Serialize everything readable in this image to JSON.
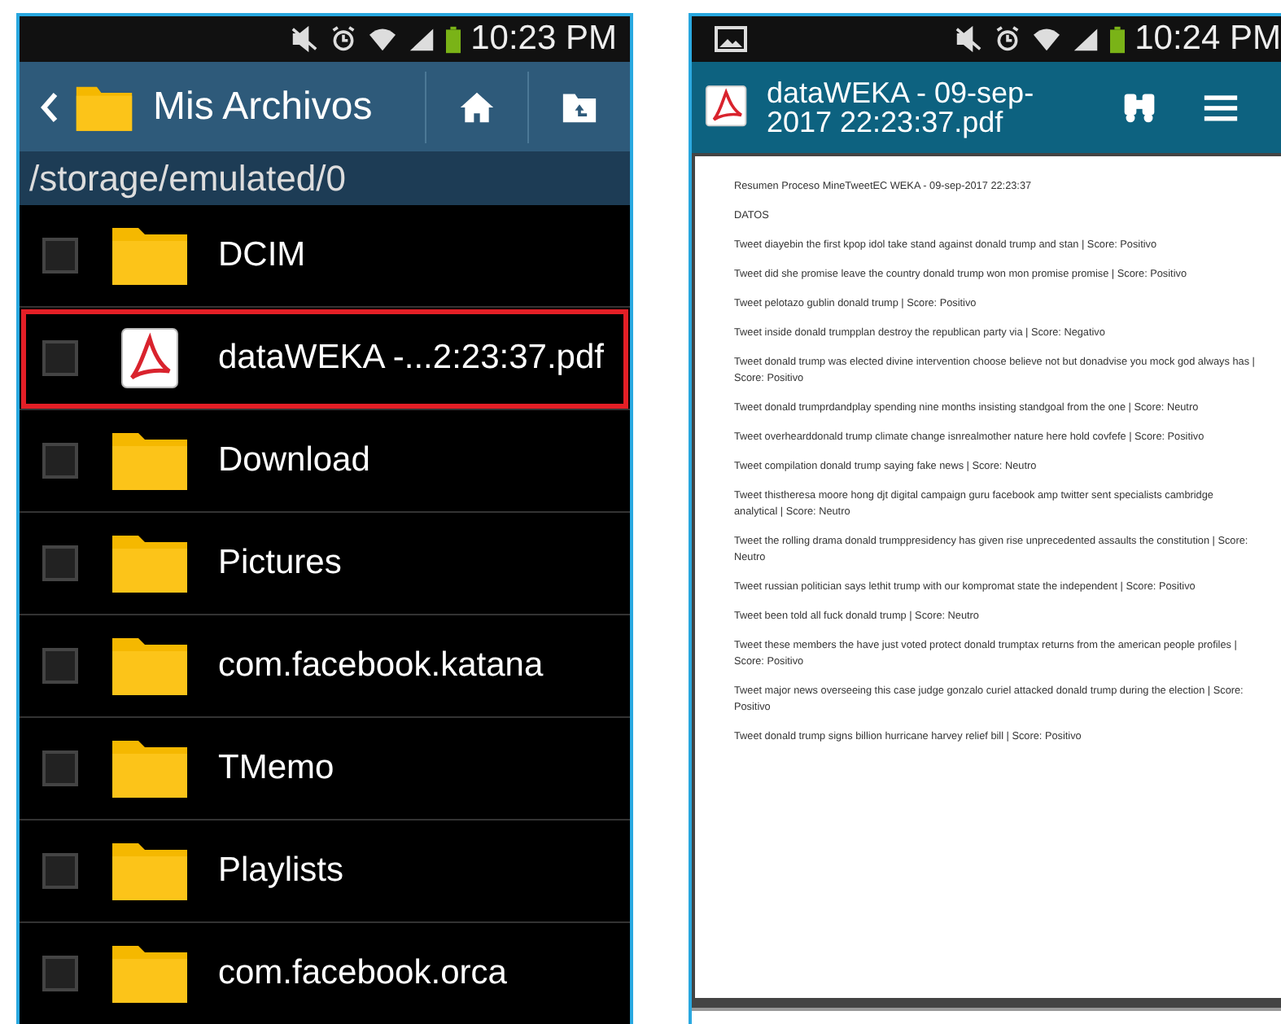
{
  "file_browser": {
    "status_bar": {
      "time": "10:23 PM"
    },
    "toolbar": {
      "title": "Mis Archivos"
    },
    "path": "/storage/emulated/0",
    "items": [
      {
        "name": "DCIM",
        "kind": "folder",
        "checked": false,
        "selected": false
      },
      {
        "name": "dataWEKA -...2:23:37.pdf",
        "kind": "pdf",
        "checked": false,
        "selected": true
      },
      {
        "name": "Download",
        "kind": "folder",
        "checked": false,
        "selected": false
      },
      {
        "name": "Pictures",
        "kind": "folder",
        "checked": false,
        "selected": false
      },
      {
        "name": "com.facebook.katana",
        "kind": "folder",
        "checked": false,
        "selected": false
      },
      {
        "name": "TMemo",
        "kind": "folder",
        "checked": false,
        "selected": false
      },
      {
        "name": "Playlists",
        "kind": "folder",
        "checked": false,
        "selected": false
      },
      {
        "name": "com.facebook.orca",
        "kind": "folder",
        "checked": false,
        "selected": false
      }
    ]
  },
  "pdf_viewer": {
    "status_bar": {
      "time": "10:24 PM"
    },
    "toolbar": {
      "title": "dataWEKA - 09-sep-2017 22:23:37.pdf"
    },
    "document": {
      "paragraphs": [
        "Resumen Proceso MineTweetEC WEKA - 09-sep-2017 22:23:37",
        "DATOS",
        "Tweet diayebin the first kpop idol take stand against donald trump and stan  | Score: Positivo",
        "Tweet did she promise leave the country donald trump won  mon promise promise | Score: Positivo",
        "Tweet pelotazo  gublin  donald trump | Score: Positivo",
        "Tweet inside donald trumpplan destroy the republican party via | Score: Negativo",
        "Tweet donald trump was elected divine intervention choose believe not but donadvise you mock god always has | Score: Positivo",
        "Tweet donald trumprdandplay spending nine months insisting standgoal from the one | Score: Neutro",
        "Tweet overhearddonald trump climate change isnrealmother nature here hold covfefe | Score: Positivo",
        "Tweet compilation donald trump saying fake news | Score: Neutro",
        "Tweet thistheresa moore hong djt digital campaign guru facebook amp twitter sent specialists cambridge analytical | Score: Neutro",
        "Tweet the rolling drama donald trumppresidency has given rise unprecedented assaults the constitution | Score: Neutro",
        "Tweet russian politician says lethit trump with our kompromat state  the independent | Score: Positivo",
        "Tweet been told all fuck donald trump | Score: Neutro",
        "Tweet these members the have just voted protect donald trumptax returns from the american people profiles | Score: Positivo",
        "Tweet major news overseeing this case judge gonzalo curiel attacked donald trump during the election | Score: Positivo",
        "Tweet  donald trump signs billion hurricane harvey relief bill | Score: Positivo"
      ]
    }
  }
}
